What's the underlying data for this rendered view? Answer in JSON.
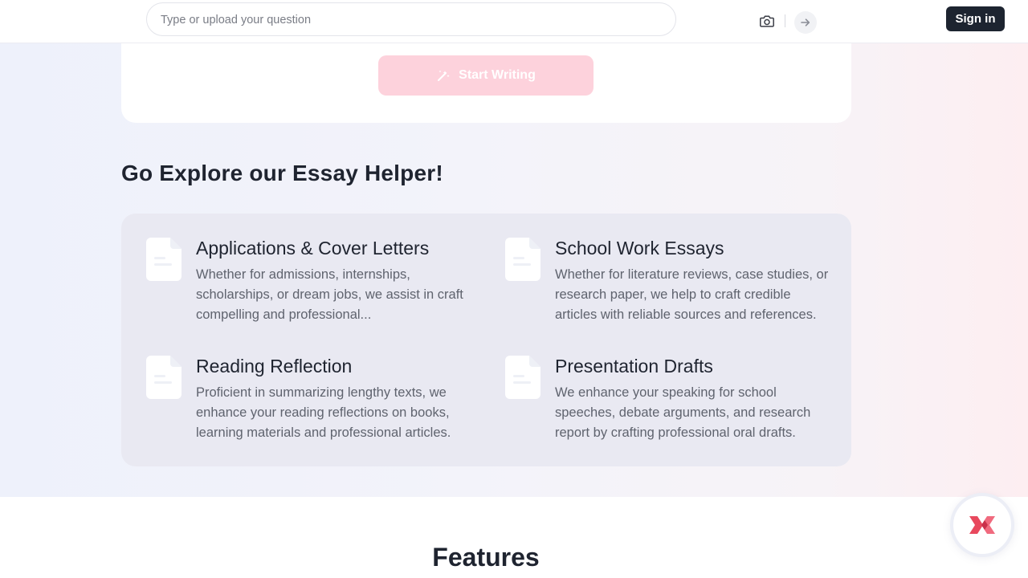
{
  "header": {
    "search": {
      "placeholder": "Type or upload your question",
      "value": "",
      "camera_icon": "camera-icon",
      "send_icon": "arrow-right-icon"
    },
    "signin_label": "Sign in"
  },
  "writer": {
    "start_label": "Start Writing",
    "start_icon": "magic-wand-icon",
    "button_color": "#fdd2dc"
  },
  "explore": {
    "title": "Go Explore our Essay Helper!",
    "items": [
      {
        "icon": "document-icon",
        "title": "Applications & Cover Letters",
        "description": "Whether for admissions, internships, scholarships, or dream jobs, we assist in craft compelling and professional..."
      },
      {
        "icon": "document-icon",
        "title": "School Work Essays",
        "description": "Whether for literature reviews, case studies, or research paper, we help to craft credible articles with reliable sources and references."
      },
      {
        "icon": "document-icon",
        "title": "Reading Reflection",
        "description": "Proficient in summarizing lengthy texts, we enhance your reading reflections on books, learning materials and professional articles."
      },
      {
        "icon": "document-icon",
        "title": "Presentation Drafts",
        "description": "We enhance your speaking for school speeches, debate arguments, and research report by crafting professional oral drafts."
      }
    ]
  },
  "features": {
    "title": "Features"
  },
  "floating": {
    "icon": "brand-logo-icon"
  },
  "colors": {
    "signin_bg": "#1d2430",
    "panel_bg": "#e9e9f2",
    "logo_red": "#e8485d"
  }
}
